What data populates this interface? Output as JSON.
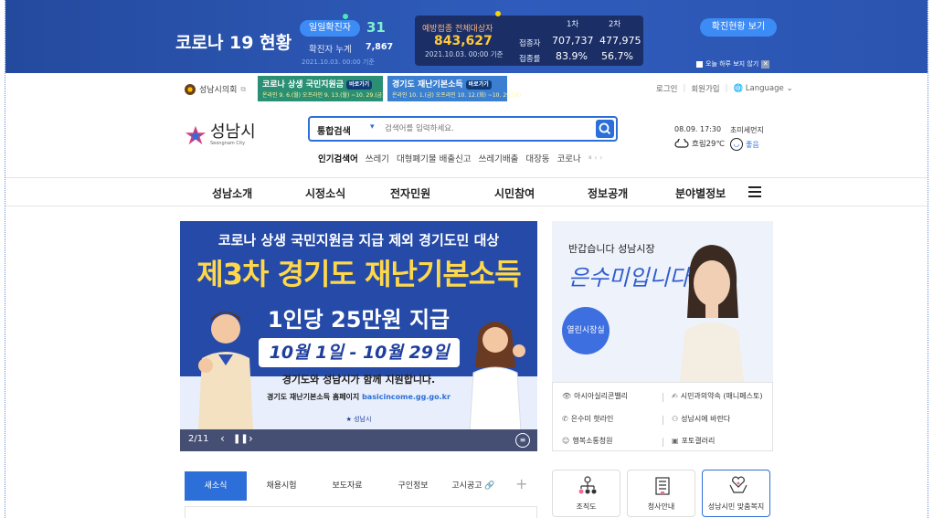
{
  "covid": {
    "title": "코로나 19 현황",
    "daily_label": "일일확진자",
    "daily_value": "31",
    "total_label": "확진자 누계",
    "total_value": "7,867",
    "date": "2021.10.03. 00:00 기준",
    "vaccine_label": "예방접종 전체대상자",
    "vaccine_total": "843,627",
    "vaccine_date": "2021.10.03. 00:00 기준",
    "col1": "1차",
    "col2": "2차",
    "row1_label": "접종자",
    "row1_v1": "707,737",
    "row1_v2": "477,975",
    "row2_label": "접종률",
    "row2_v1": "83.9%",
    "row2_v2": "56.7%",
    "check_button": "확진현황 보기",
    "noshow_label": "오늘 하루 보지 않기"
  },
  "util": {
    "council": "성남시의회",
    "promo1_title": "코로나 상생 국민지원금",
    "promo1_go": "바로가기",
    "promo1_sub": "온라인 9. 6.(월) 오프라인 9. 13.(월) ~10. 29.(금)",
    "promo2_title": "경기도 재난기본소득",
    "promo2_go": "바로가기",
    "promo2_sub": "온라인 10. 1.(금) 오프라인 10. 12.(화) ~10. 29.(금)",
    "login": "로그인",
    "join": "회원가입",
    "language": "Language"
  },
  "header": {
    "logo_name": "성남시",
    "logo_sub": "Seongnam City",
    "search_category": "통합검색",
    "search_placeholder": "검색어를 입력하세요.",
    "popular_label": "인기검색어",
    "popular": [
      "쓰레기",
      "대형폐기물 배출신고",
      "쓰레기배출",
      "대장동",
      "코로나"
    ],
    "weather_time": "08.09. 17:30",
    "weather_text": "흐림29℃",
    "dust_label": "초미세먼지",
    "dust_value": "좋음"
  },
  "nav": [
    "성남소개",
    "시정소식",
    "전자민원",
    "시민참여",
    "정보공개",
    "분야별정보"
  ],
  "banner": {
    "line1": "코로나 상생 국민지원금 지급 제외 경기도민 대상",
    "line2": "제3차 경기도 재난기본소득",
    "line3": "1인당 25만원 지급",
    "date": "10월 1일 - 10월 29일",
    "sub": "경기도와 성남시가 함께 지원합니다.",
    "url_label": "경기도 재난기본소득 홈페이지",
    "url": "basicincome.gg.go.kr",
    "foot": "성남시",
    "page": "2/11"
  },
  "mayor": {
    "greeting": "반갑습니다 성남시장",
    "name": "은수미입니다",
    "open_office": "열린시장실",
    "links": [
      "아시아실리콘밸리",
      "시민과의약속 (매니페스토)",
      "은수미 핫라인",
      "성남시에 바란다",
      "행복소통청원",
      "포토갤러리"
    ]
  },
  "tabs": [
    "새소식",
    "채용시험",
    "보도자료",
    "구인정보",
    "고시공고"
  ],
  "quick": [
    "조직도",
    "청사안내",
    "성남시민 맞춤복지"
  ],
  "colors": {
    "primary": "#2c6fd8",
    "banner_navy": "#254aa8",
    "accent_yellow": "#ffd84a"
  }
}
